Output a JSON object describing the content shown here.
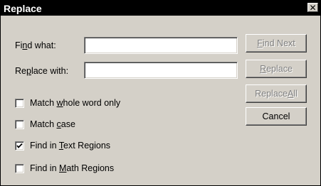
{
  "window": {
    "title": "Replace",
    "close_glyph": "✕"
  },
  "fields": {
    "find_what": {
      "label_pre": "Fi",
      "label_key": "n",
      "label_post": "d what:",
      "value": ""
    },
    "replace_with": {
      "label_pre": "Re",
      "label_key": "p",
      "label_post": "lace with:",
      "value": ""
    }
  },
  "buttons": {
    "find_next": {
      "pre": "",
      "key": "F",
      "post": "ind Next",
      "enabled": false
    },
    "replace": {
      "pre": "",
      "key": "R",
      "post": "eplace",
      "enabled": false
    },
    "replace_all": {
      "pre": "Replace ",
      "key": "A",
      "post": "ll",
      "enabled": false
    },
    "cancel": {
      "pre": "Cancel",
      "key": "",
      "post": "",
      "enabled": true
    }
  },
  "options": [
    {
      "pre": "Match ",
      "key": "w",
      "post": "hole word only",
      "checked": false
    },
    {
      "pre": "Match ",
      "key": "c",
      "post": "ase",
      "checked": false
    },
    {
      "pre": "Find in ",
      "key": "T",
      "post": "ext Regions",
      "checked": true
    },
    {
      "pre": "Find in ",
      "key": "M",
      "post": "ath Regions",
      "checked": false
    }
  ]
}
